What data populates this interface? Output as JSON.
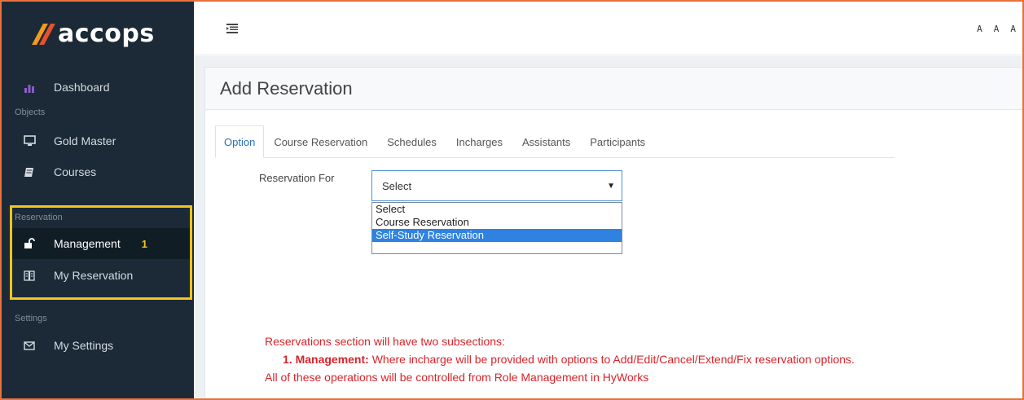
{
  "brand": {
    "name": "accops"
  },
  "sidebar": {
    "dashboard": "Dashboard",
    "objects_label": "Objects",
    "gold_master": "Gold Master",
    "courses": "Courses",
    "reservation_label": "Reservation",
    "management": "Management",
    "management_badge": "1",
    "my_reservation": "My Reservation",
    "settings_label": "Settings",
    "my_settings": "My Settings"
  },
  "topbar": {
    "font_sizes": [
      "A",
      "A",
      "A"
    ]
  },
  "page": {
    "title": "Add Reservation"
  },
  "tabs": [
    {
      "label": "Option",
      "active": true
    },
    {
      "label": "Course Reservation"
    },
    {
      "label": "Schedules"
    },
    {
      "label": "Incharges"
    },
    {
      "label": "Assistants"
    },
    {
      "label": "Participants"
    }
  ],
  "form": {
    "reservation_for_label": "Reservation For",
    "reservation_for_value": "Select",
    "options": [
      "Select",
      "Course Reservation",
      "Self-Study Reservation"
    ],
    "highlighted_option": "Self-Study Reservation"
  },
  "annotation": {
    "line1": "Reservations section will have two subsections:",
    "line2_bold": "1. Management:",
    "line2_rest": " Where incharge will be provided with options to Add/Edit/Cancel/Extend/Fix reservation options.",
    "line3": "All of these operations will be controlled from Role Management in HyWorks"
  },
  "colors": {
    "sidebar_bg": "#1b2a36",
    "highlight_box": "#f7c31b",
    "accent": "#2a6fb5",
    "annotation": "#d9232a"
  }
}
